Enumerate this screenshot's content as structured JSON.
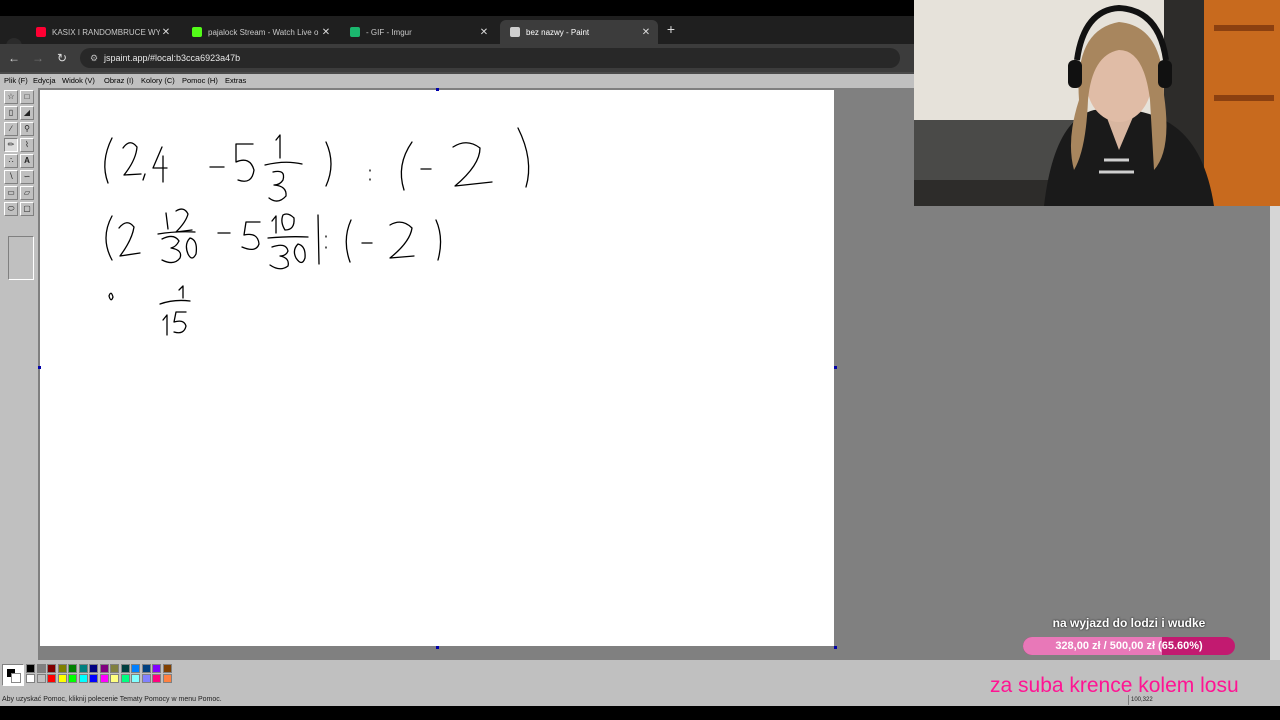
{
  "browser": {
    "tabs": [
      {
        "title": "KASIX I RANDOMBRUCE WYJA",
        "favicon_color": "#ff0033",
        "favicon": "youtube-icon"
      },
      {
        "title": "pajalock Stream - Watch Live o",
        "favicon_color": "#53fc18",
        "favicon": "kick-icon"
      },
      {
        "title": "- GIF - Imgur",
        "favicon_color": "#1bb76e",
        "favicon": "imgur-icon"
      },
      {
        "title": "bez nazwy - Paint",
        "favicon_color": "#cccccc",
        "favicon": "paint-icon",
        "active": true
      }
    ],
    "new_tab_label": "+",
    "url": "jspaint.app/#local:b3cca6923a47b"
  },
  "paint": {
    "menu": [
      "Plik (F)",
      "Edycja",
      "Widok (V)",
      "Obraz (I)",
      "Kolory (C)",
      "Pomoc (H)",
      "Extras"
    ],
    "status_message": "Aby uzyskać Pomoc, kliknij polecenie Tematy Pomocy w menu Pomoc.",
    "coordinates": "100,322",
    "palette_top": [
      "#000000",
      "#808080",
      "#800000",
      "#808000",
      "#008000",
      "#008080",
      "#000080",
      "#800080",
      "#808040",
      "#004040",
      "#0080ff",
      "#004080",
      "#8000ff",
      "#804000"
    ],
    "palette_bottom": [
      "#ffffff",
      "#c0c0c0",
      "#ff0000",
      "#ffff00",
      "#00ff00",
      "#00ffff",
      "#0000ff",
      "#ff00ff",
      "#ffff80",
      "#00ff80",
      "#80ffff",
      "#8080ff",
      "#ff0080",
      "#ff8040"
    ],
    "primary_color": "#000000",
    "secondary_color": "#ffffff"
  },
  "goal": {
    "title": "na wyjazd do lodzi i wudke",
    "progress_text": "328,00 zł / 500,00 zł (65.60%)",
    "progress": 0.656
  },
  "promo": "za suba krence kolem losu",
  "colors": {
    "goal_track": "#c21a70",
    "goal_fill": "#e878b8",
    "promo_text": "#ff1493"
  }
}
